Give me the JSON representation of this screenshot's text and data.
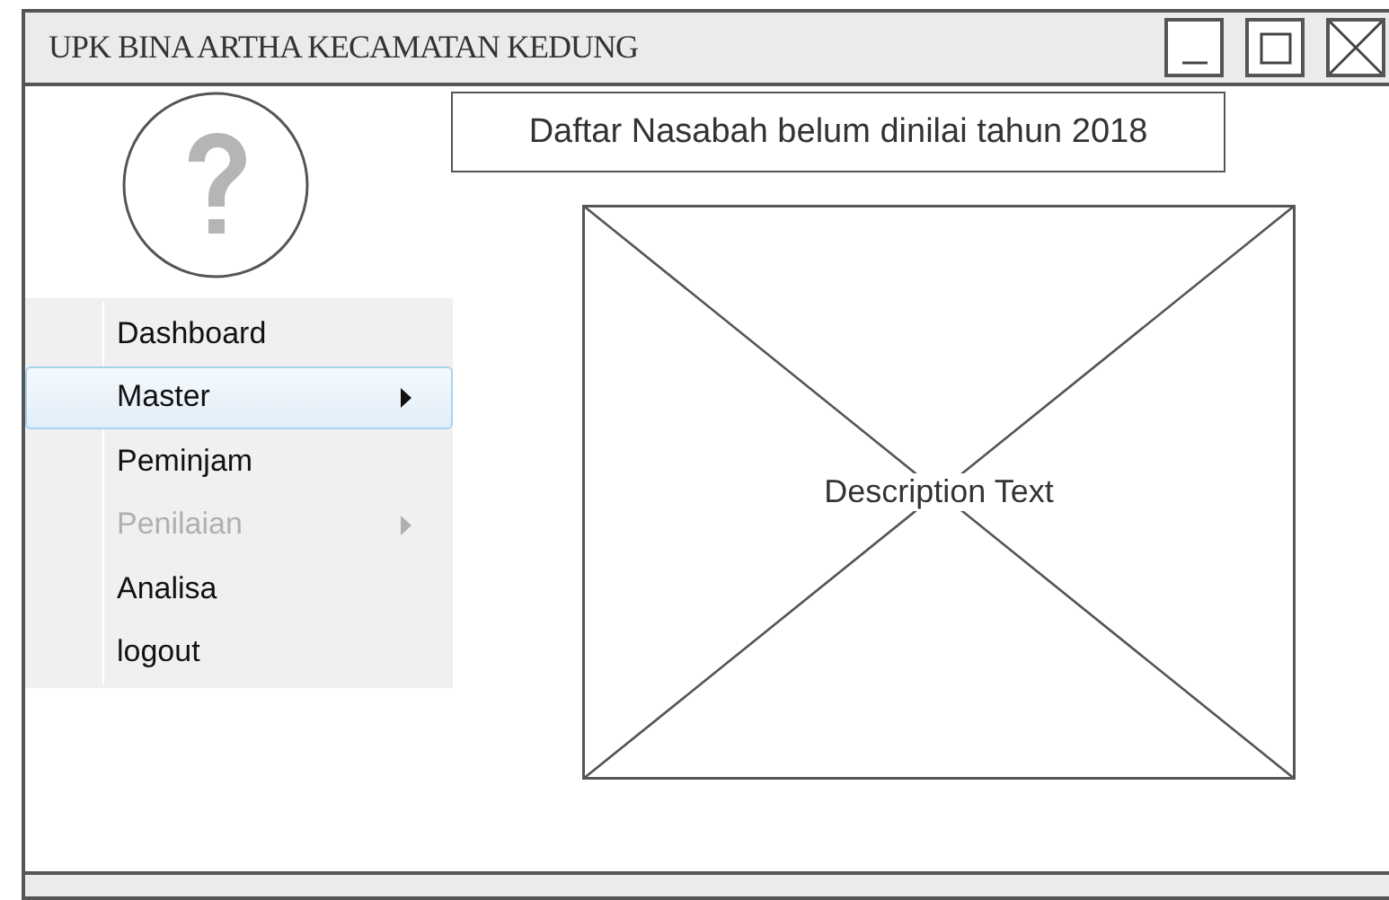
{
  "window": {
    "title": "UPK BINA ARTHA KECAMATAN KEDUNG"
  },
  "header_label": "Daftar Nasabah belum dinilai tahun 2018",
  "menu": {
    "items": [
      {
        "label": "Dashboard",
        "selected": false,
        "disabled": false,
        "submenu": false
      },
      {
        "label": "Master",
        "selected": true,
        "disabled": false,
        "submenu": true
      },
      {
        "label": "Peminjam",
        "selected": false,
        "disabled": false,
        "submenu": false
      },
      {
        "label": "Penilaian",
        "selected": false,
        "disabled": true,
        "submenu": true
      },
      {
        "label": "Analisa",
        "selected": false,
        "disabled": false,
        "submenu": false
      },
      {
        "label": "logout",
        "selected": false,
        "disabled": false,
        "submenu": false
      }
    ]
  },
  "image_placeholder": {
    "caption": "Description Text"
  }
}
